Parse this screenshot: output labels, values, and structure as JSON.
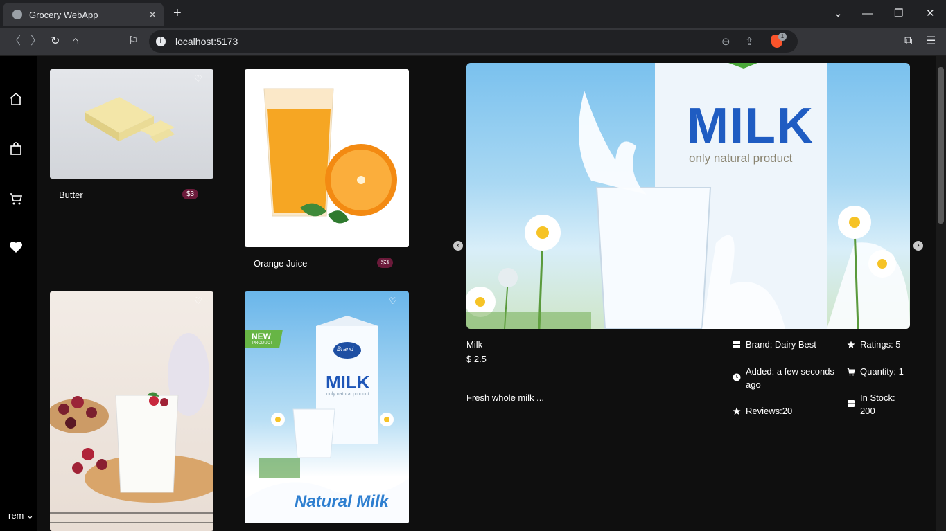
{
  "browser": {
    "tab_title": "Grocery WebApp",
    "url": "localhost:5173",
    "shield_count": "1"
  },
  "sidebar": {
    "user_label": "rem"
  },
  "products": [
    {
      "name": "Butter",
      "price": "$3"
    },
    {
      "name": "Orange Juice",
      "price": "$3"
    }
  ],
  "detail": {
    "name": "Milk",
    "price": "$ 2.5",
    "description": "Fresh whole milk ...",
    "brand": "Brand: Dairy Best",
    "added": "Added: a few seconds ago",
    "reviews": "Reviews:20",
    "ratings": "Ratings: 5",
    "quantity": "Quantity: 1",
    "in_stock": "In Stock: 200",
    "hero_text": "MILK",
    "hero_sub": "only natural product"
  },
  "milk_card": {
    "badge": "NEW",
    "badge_sub": "PRODUCT",
    "brand": "Brand",
    "title": "MILK",
    "sub": "only natural product",
    "script": "Natural Milk"
  }
}
